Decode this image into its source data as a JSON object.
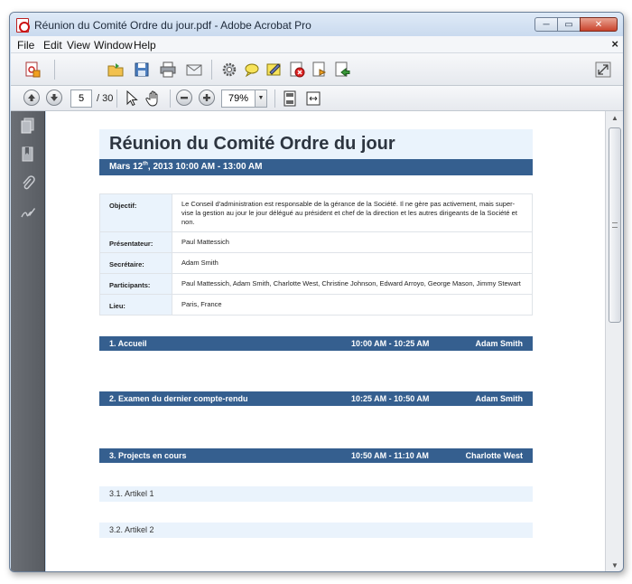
{
  "window": {
    "title": "Réunion du Comité Ordre du jour.pdf - Adobe Acrobat Pro",
    "buttons": {
      "minimize": "─",
      "maximize": "▭",
      "close": "✕"
    }
  },
  "menubar": {
    "items": [
      "File",
      "Edit",
      "View",
      "Window",
      "Help"
    ],
    "close_doc": "×"
  },
  "navigation": {
    "current_page": "5",
    "total_pages": "/ 30",
    "zoom": "79%"
  },
  "document": {
    "title": "Réunion du Comité Ordre du jour",
    "date_prefix": "Mars 12",
    "date_sup": "th",
    "date_suffix": ", 2013  10:00 AM - 13:00 AM",
    "info": [
      {
        "label": "Objectif:",
        "value": "Le Conseil d'administration est responsable de la gérance de la Société. Il ne gère pas activement, mais super-vise la gestion au jour le jour délégué au président et chef de la direction et les autres dirigeants de la Société et non."
      },
      {
        "label": "Présentateur:",
        "value": "Paul Mattessich"
      },
      {
        "label": "Secrétaire:",
        "value": "Adam Smith"
      },
      {
        "label": "Participants:",
        "value": "Paul Mattessich, Adam Smith, Charlotte West, Christine Johnson, Edward Arroyo, George Mason, Jimmy Stewart"
      },
      {
        "label": "Lieu:",
        "value": "Paris, France"
      }
    ],
    "sections": [
      {
        "title": "1. Accueil",
        "time": "10:00 AM - 10:25 AM",
        "presenter": "Adam Smith"
      },
      {
        "title": "2. Examen du dernier compte-rendu",
        "time": "10:25 AM - 10:50 AM",
        "presenter": "Adam Smith"
      },
      {
        "title": "3. Projects en cours",
        "time": "10:50 AM - 11:10 AM",
        "presenter": "Charlotte West"
      }
    ],
    "subitems": [
      "3.1. Artikel 1",
      "3.2. Artikel 2"
    ]
  },
  "colors": {
    "accent_bar": "#355f8f",
    "light_band": "#eaf3fc",
    "side_panel": "#5f6369"
  },
  "icons": {
    "toolbar_top": [
      "create-pdf-icon",
      "open-folder-icon",
      "save-icon",
      "print-icon",
      "email-icon",
      "settings-icon",
      "comment-icon",
      "sign-icon",
      "redact-icon",
      "forms-icon",
      "export-icon",
      "fullscreen-icon"
    ],
    "toolbar_nav": [
      "prev-page-icon",
      "next-page-icon",
      "select-arrow-icon",
      "hand-icon",
      "zoom-out-icon",
      "zoom-in-icon",
      "fit-page-icon",
      "fit-width-icon"
    ],
    "side_panel": [
      "pages-icon",
      "bookmarks-icon",
      "attachments-icon",
      "signatures-icon"
    ]
  }
}
